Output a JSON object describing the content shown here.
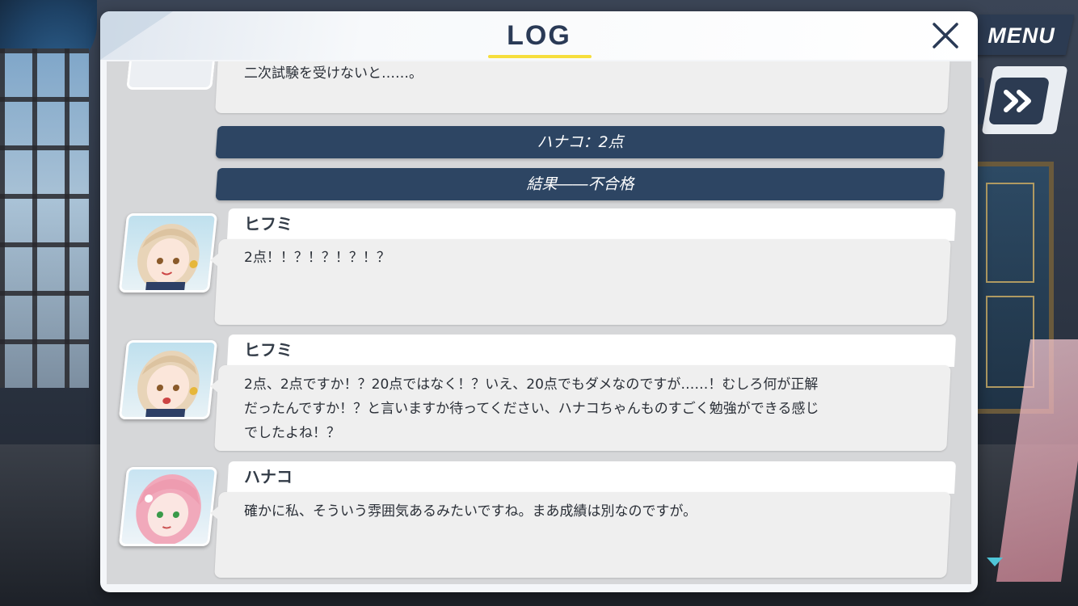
{
  "hud": {
    "menu_label": "MENU"
  },
  "log": {
    "title": "LOG",
    "entries": [
      {
        "type": "dialogue",
        "speaker": "",
        "text": "二次試験を受けないと……。"
      },
      {
        "type": "system",
        "text": "ハナコ：2点"
      },
      {
        "type": "system",
        "text": "結果――不合格"
      },
      {
        "type": "dialogue",
        "speaker": "ヒフミ",
        "text": "2点！！？！？！？！？"
      },
      {
        "type": "dialogue",
        "speaker": "ヒフミ",
        "text": "2点、2点ですか！？20点ではなく！？いえ、20点でもダメなのですが……！むしろ何が正解\nだったんですか！？と言いますか待ってください、ハナコちゃんものすごく勉強ができる感じ\nでしたよね！？"
      },
      {
        "type": "dialogue",
        "speaker": "ハナコ",
        "text": "確かに私、そういう雰囲気あるみたいですね。まあ成績は別なのですが。"
      }
    ]
  },
  "colors": {
    "system_bar": "#2d4563",
    "title_underline": "#f6de3c",
    "menu_button": "#2c3b52",
    "scroll_indicator": "#4fc6d8"
  },
  "icons": {
    "close": "close-icon",
    "skip": "fast-forward-icon",
    "scroll": "scroll-down-arrow-icon"
  }
}
